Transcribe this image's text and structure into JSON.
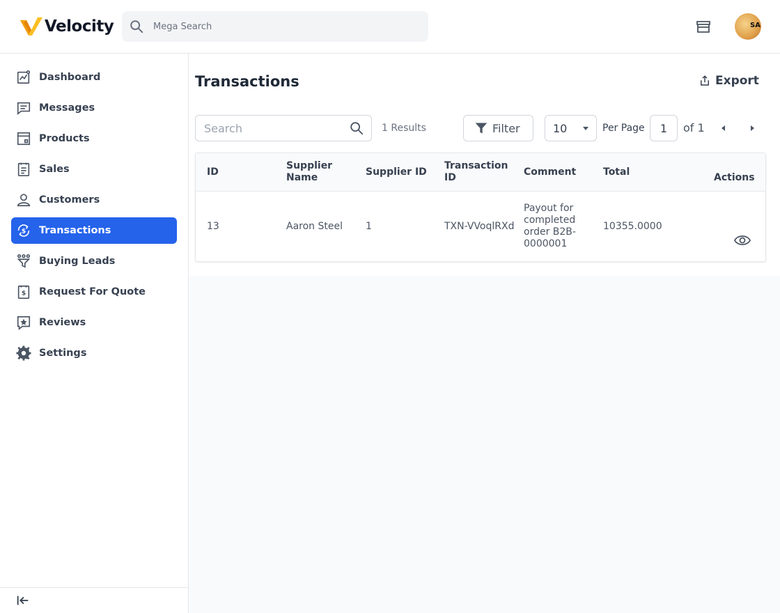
{
  "app": {
    "brand": "Velocity",
    "search_placeholder": "Mega Search",
    "avatar_text": "SAI"
  },
  "sidebar": {
    "items": [
      {
        "label": "Dashboard",
        "icon": "dashboard-chart-icon"
      },
      {
        "label": "Messages",
        "icon": "message-icon"
      },
      {
        "label": "Products",
        "icon": "products-icon"
      },
      {
        "label": "Sales",
        "icon": "sales-receipt-icon"
      },
      {
        "label": "Customers",
        "icon": "user-icon"
      },
      {
        "label": "Transactions",
        "icon": "transactions-dollar-icon",
        "active": true
      },
      {
        "label": "Buying Leads",
        "icon": "funnel-leads-icon"
      },
      {
        "label": "Request For Quote",
        "icon": "quote-clipboard-icon"
      },
      {
        "label": "Reviews",
        "icon": "star-review-icon"
      },
      {
        "label": "Settings",
        "icon": "gear-icon"
      }
    ]
  },
  "page": {
    "title": "Transactions",
    "export_label": "Export"
  },
  "toolbar": {
    "search_placeholder": "Search",
    "results": "1 Results",
    "filter_label": "Filter",
    "per_page_value": "10",
    "per_page_label": "Per Page",
    "page_value": "1",
    "of_label": "of 1"
  },
  "table": {
    "columns": [
      "ID",
      "Supplier Name",
      "Supplier ID",
      "Transaction ID",
      "Comment",
      "Total",
      "Actions"
    ],
    "rows": [
      {
        "id": "13",
        "supplier_name": "Aaron Steel",
        "supplier_id": "1",
        "transaction_id": "TXN-VVoqlRXd",
        "comment": "Payout for completed order B2B-0000001",
        "total": "10355.0000"
      }
    ]
  },
  "colors": {
    "accent": "#2563eb",
    "brand_orange": "#f59e0b"
  }
}
